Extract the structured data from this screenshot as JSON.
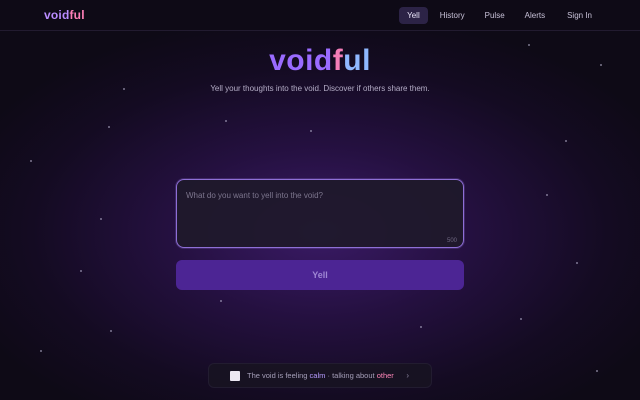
{
  "nav": {
    "logo_part1": "void",
    "logo_part2": "ful",
    "links": [
      "Yell",
      "History",
      "Pulse",
      "Alerts",
      "Sign In"
    ],
    "active": "Yell"
  },
  "hero": {
    "title_part1": "void",
    "title_part2": "f",
    "title_part3": "ul",
    "subtitle": "Yell your thoughts into the void. Discover if others share them."
  },
  "yell": {
    "placeholder": "What do you want to yell into the void?",
    "value": "",
    "char_limit": "500",
    "button_label": "Yell"
  },
  "mood": {
    "prefix": "The void is feeling",
    "mood_word": "calm",
    "middle": "· talking about",
    "topic": "other",
    "chevron": "›"
  },
  "colors": {
    "accent": "#9a6bff",
    "pink": "#f47db8",
    "button": "#4c2594"
  }
}
